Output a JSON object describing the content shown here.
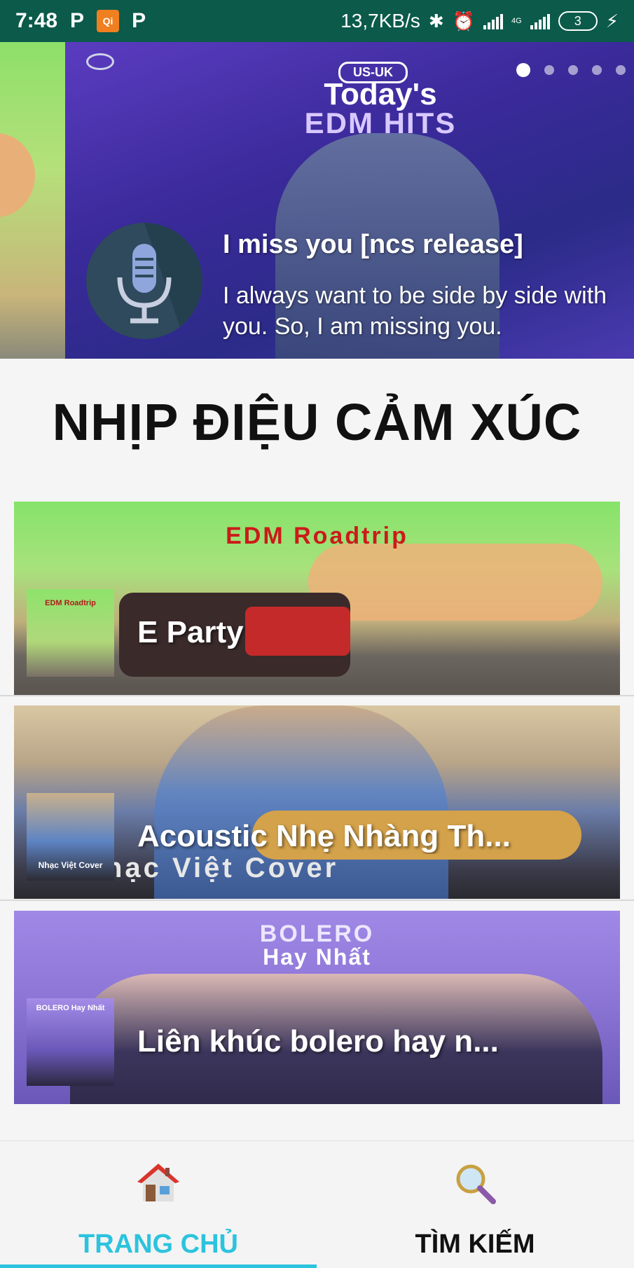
{
  "status_bar": {
    "time": "7:48",
    "notification_icons": [
      "P",
      "P"
    ],
    "app_badge_label": "Qi",
    "net_speed": "13,7KB/s",
    "network": "4G",
    "battery_level": "3"
  },
  "hero": {
    "chip": "US-UK",
    "title_line1": "Today's",
    "title_line2": "EDM HITS",
    "song_title": "I miss you [ncs release]",
    "song_description": "I always want to be side by side with you. So, I am missing you.",
    "page_dots": 5,
    "active_dot": 0,
    "mic_icon": "microphone-icon"
  },
  "section_title": "NHỊP ĐIỆU CẢM XÚC",
  "playlists": [
    {
      "label": "E Party",
      "cover_text": "EDM Roadtrip",
      "thumb_text": "EDM Roadtrip"
    },
    {
      "label": "Acoustic Nhẹ Nhàng Th...",
      "cover_text": "hạc Việt Cover",
      "thumb_text": "Nhạc Việt Cover"
    },
    {
      "label": "Liên khúc bolero hay n...",
      "cover_text_line1": "BOLERO",
      "cover_text_line2": "Hay Nhất",
      "thumb_text": "BOLERO Hay Nhất"
    }
  ],
  "bottom_nav": {
    "items": [
      {
        "label": "TRANG CHỦ",
        "icon": "home-icon",
        "active": true
      },
      {
        "label": "TÌM KIẾM",
        "icon": "search-icon",
        "active": false
      }
    ],
    "active_color": "#2cc3de"
  }
}
